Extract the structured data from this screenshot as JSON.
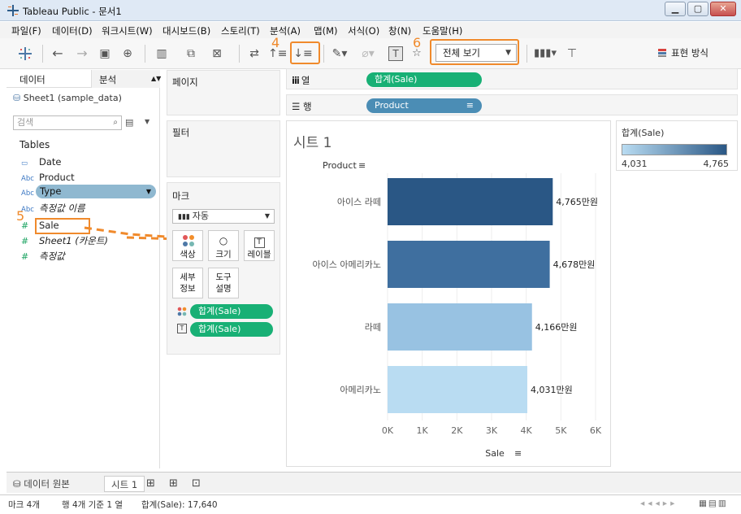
{
  "window": {
    "title": "Tableau Public - 문서1",
    "minimize": "▁",
    "maximize": "▢",
    "close": "✕"
  },
  "menu": [
    "파일(F)",
    "데이터(D)",
    "워크시트(W)",
    "대시보드(B)",
    "스토리(T)",
    "분석(A)",
    "맵(M)",
    "서식(O)",
    "창(N)",
    "도움말(H)"
  ],
  "toolbar": {
    "view_mode": "전체 보기",
    "present_label": "표현 방식",
    "annotation_sort": "4",
    "annotation_view": "6"
  },
  "data_pane": {
    "tab_data": "데이터",
    "tab_analysis": "분석",
    "datasource": "Sheet1 (sample_data)",
    "search_placeholder": "검색",
    "section": "Tables",
    "fields": [
      {
        "type": "date",
        "type_label": "▭",
        "label": "Date"
      },
      {
        "type": "dim",
        "type_label": "Abc",
        "label": "Product"
      },
      {
        "type": "dim",
        "type_label": "Abc",
        "label": "Type"
      },
      {
        "type": "dim",
        "type_label": "Abc",
        "label": "측정값 이름"
      },
      {
        "type": "measure",
        "type_label": "#",
        "label": "Sale"
      },
      {
        "type": "measure",
        "type_label": "#",
        "label": "Sheet1 (카운트)"
      },
      {
        "type": "measure",
        "type_label": "#",
        "label": "측정값"
      }
    ],
    "annotation_sale": "5"
  },
  "shelves": {
    "pages": "페이지",
    "filters": "필터",
    "marks": "마크",
    "mark_type": "자동",
    "mark_buttons": {
      "color": "색상",
      "size": "크기",
      "label": "레이블",
      "detail_1": "세부",
      "detail_2": "정보",
      "tooltip_1": "도구",
      "tooltip_2": "설명"
    },
    "mark_pills": [
      "합계(Sale)",
      "합계(Sale)"
    ],
    "columns_label": "열",
    "rows_label": "행",
    "columns_pill": "합계(Sale)",
    "rows_pill": "Product"
  },
  "colors": {
    "measure_pill": "#18b075",
    "dimension_pill": "#4b8db5",
    "highlight": "#f08a2c"
  },
  "sheet": {
    "title": "시트 1"
  },
  "legend": {
    "title": "합계(Sale)",
    "min": "4,031",
    "max": "4,765"
  },
  "chart_data": {
    "type": "bar",
    "orientation": "horizontal",
    "title": "시트 1",
    "categories": [
      "아이스 라떼",
      "아이스 아메리카노",
      "라떼",
      "아메리카노"
    ],
    "values": [
      4765,
      4678,
      4166,
      4031
    ],
    "data_labels": [
      "4,765만원",
      "4,678만원",
      "4,166만원",
      "4,031만원"
    ],
    "colors": [
      "#2a5785",
      "#3f6f9f",
      "#98c2e2",
      "#b9dcf2"
    ],
    "xlabel": "Sale",
    "ylabel": "Product",
    "xlim": [
      0,
      6000
    ],
    "xticks": [
      "0K",
      "1K",
      "2K",
      "3K",
      "4K",
      "5K",
      "6K"
    ],
    "grid": true
  },
  "sheetbar": {
    "datasource_tab": "데이터 원본",
    "sheet_tab": "시트 1"
  },
  "status": {
    "marks": "마크 4개",
    "rows": "행 4개 기준 1 열",
    "sum": "합계(Sale): 17,640"
  }
}
